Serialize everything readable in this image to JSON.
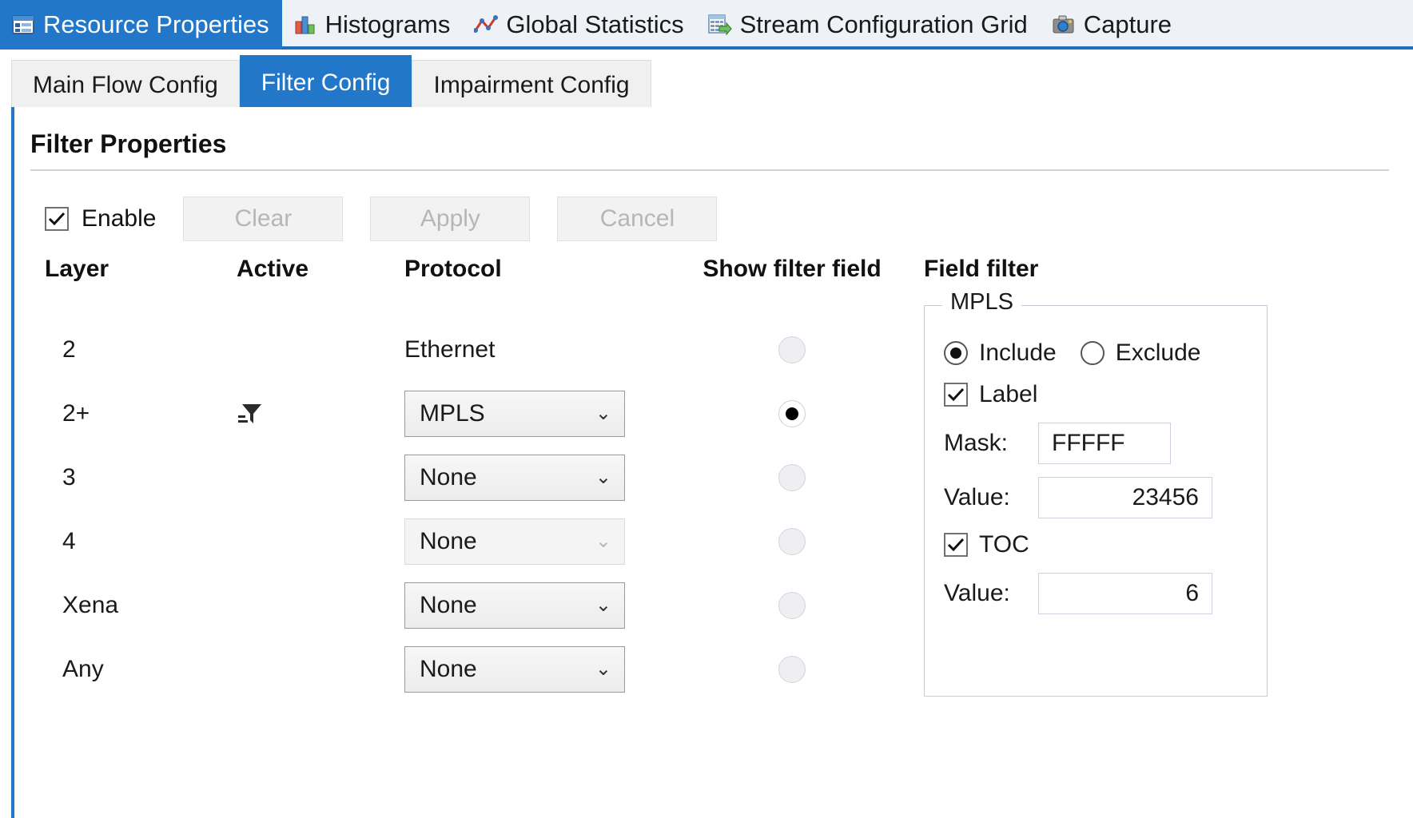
{
  "outer_tabs": [
    {
      "label": "Resource Properties",
      "icon": "resource-properties-icon",
      "active": true
    },
    {
      "label": "Histograms",
      "icon": "histograms-icon",
      "active": false
    },
    {
      "label": "Global Statistics",
      "icon": "global-statistics-icon",
      "active": false
    },
    {
      "label": "Stream Configuration Grid",
      "icon": "stream-configuration-grid-icon",
      "active": false
    },
    {
      "label": "Capture",
      "icon": "capture-icon",
      "active": false
    }
  ],
  "inner_tabs": [
    {
      "label": "Main Flow Config",
      "active": false
    },
    {
      "label": "Filter Config",
      "active": true
    },
    {
      "label": "Impairment Config",
      "active": false
    }
  ],
  "panel": {
    "title": "Filter Properties",
    "enable_label": "Enable",
    "enable_checked": true,
    "buttons": [
      {
        "label": "Clear",
        "enabled": false
      },
      {
        "label": "Apply",
        "enabled": false
      },
      {
        "label": "Cancel",
        "enabled": false
      }
    ]
  },
  "table": {
    "headers": [
      "Layer",
      "Active",
      "Protocol",
      "Show filter field",
      "Field filter"
    ],
    "rows": [
      {
        "layer": "2",
        "active_icon": "",
        "protocol": "Ethernet",
        "protocol_is_combo": false,
        "combo_enabled": false,
        "show_filter_field": false
      },
      {
        "layer": "2+",
        "active_icon": "filter-icon",
        "protocol": "MPLS",
        "protocol_is_combo": true,
        "combo_enabled": true,
        "show_filter_field": true
      },
      {
        "layer": "3",
        "active_icon": "",
        "protocol": "None",
        "protocol_is_combo": true,
        "combo_enabled": true,
        "show_filter_field": false
      },
      {
        "layer": "4",
        "active_icon": "",
        "protocol": "None",
        "protocol_is_combo": true,
        "combo_enabled": false,
        "show_filter_field": false
      },
      {
        "layer": "Xena",
        "active_icon": "",
        "protocol": "None",
        "protocol_is_combo": true,
        "combo_enabled": true,
        "show_filter_field": false
      },
      {
        "layer": "Any",
        "active_icon": "",
        "protocol": "None",
        "protocol_is_combo": true,
        "combo_enabled": true,
        "show_filter_field": false
      }
    ]
  },
  "field_filter": {
    "legend": "MPLS",
    "mode": {
      "include_label": "Include",
      "exclude_label": "Exclude",
      "selected": "Include"
    },
    "label_checkbox": {
      "label": "Label",
      "checked": true
    },
    "mask_label": "Mask:",
    "mask_value": "FFFFF",
    "label_value_label": "Value:",
    "label_value": "23456",
    "toc_checkbox": {
      "label": "TOC",
      "checked": true
    },
    "toc_value_label": "Value:",
    "toc_value": "6"
  },
  "colors": {
    "accent": "#2277c8",
    "tabstrip_bg": "#eef1f6",
    "pane_bg": "#ffffff",
    "disabled_text": "#b6b6b6"
  }
}
